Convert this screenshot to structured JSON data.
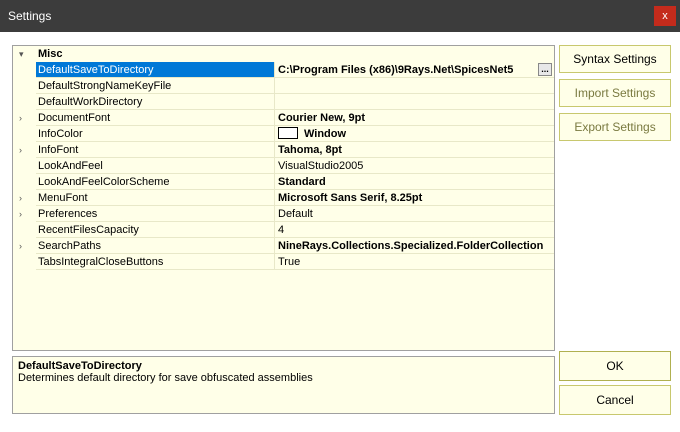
{
  "window": {
    "title": "Settings",
    "close_glyph": "x"
  },
  "grid": {
    "category": {
      "label": "Misc",
      "expander": "▾"
    },
    "rows": [
      {
        "name": "DefaultSaveToDirectory",
        "value": "C:\\Program Files (x86)\\9Rays.Net\\SpicesNet5",
        "bold": true,
        "selected": true,
        "expandable": false,
        "ellipsis": "..."
      },
      {
        "name": "DefaultStrongNameKeyFile",
        "value": "",
        "bold": false,
        "expandable": false
      },
      {
        "name": "DefaultWorkDirectory",
        "value": "",
        "bold": false,
        "expandable": false
      },
      {
        "name": "DocumentFont",
        "value": "Courier New, 9pt",
        "bold": true,
        "expandable": true
      },
      {
        "name": "InfoColor",
        "value": "Window",
        "bold": true,
        "expandable": false,
        "swatch": "#ffffff"
      },
      {
        "name": "InfoFont",
        "value": "Tahoma, 8pt",
        "bold": true,
        "expandable": true
      },
      {
        "name": "LookAndFeel",
        "value": "VisualStudio2005",
        "bold": false,
        "expandable": false
      },
      {
        "name": "LookAndFeelColorScheme",
        "value": "Standard",
        "bold": true,
        "expandable": false
      },
      {
        "name": "MenuFont",
        "value": "Microsoft Sans Serif, 8.25pt",
        "bold": true,
        "expandable": true
      },
      {
        "name": "Preferences",
        "value": "Default",
        "bold": false,
        "expandable": true
      },
      {
        "name": "RecentFilesCapacity",
        "value": "4",
        "bold": false,
        "expandable": false
      },
      {
        "name": "SearchPaths",
        "value": "NineRays.Collections.Specialized.FolderCollection",
        "bold": true,
        "expandable": true
      },
      {
        "name": "TabsIntegralCloseButtons",
        "value": "True",
        "bold": false,
        "expandable": false
      }
    ]
  },
  "help": {
    "title": "DefaultSaveToDirectory",
    "description": "Determines default directory for save obfuscated assemblies"
  },
  "buttons": {
    "syntax": "Syntax Settings",
    "import": "Import Settings",
    "export": "Export Settings",
    "ok": "OK",
    "cancel": "Cancel"
  },
  "colors": {
    "selection": "#0078d7",
    "grid_bg": "#ffffe8",
    "titlebar": "#3c3c3c",
    "close": "#c42b1c"
  }
}
